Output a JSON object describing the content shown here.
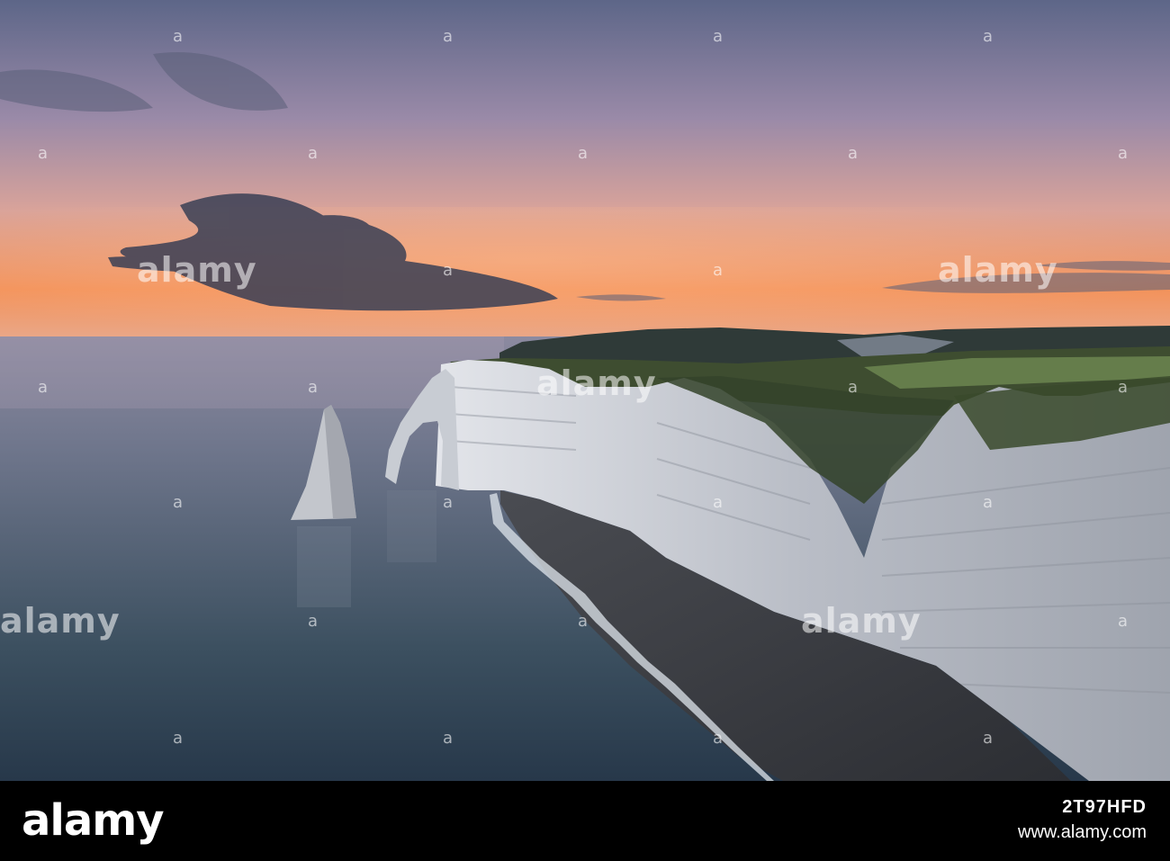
{
  "photo": {
    "scene": "coastal-chalk-cliffs-at-dusk",
    "colors": {
      "sky_top": "#5f6a8a",
      "sky_mid": "#b391a9",
      "sky_horizon": "#f08a4d",
      "sea": "#5c6a7e",
      "sea_dark": "#2f3c4c",
      "cliff": "#c9ccd2",
      "grass": "#4c5a3c",
      "beach": "#3d3f45"
    }
  },
  "watermark": {
    "logo_text": "alamy",
    "mark_glyph": "a"
  },
  "footer": {
    "logo_text": "alamy",
    "image_id": "2T97HFD",
    "site": "www.alamy.com"
  }
}
